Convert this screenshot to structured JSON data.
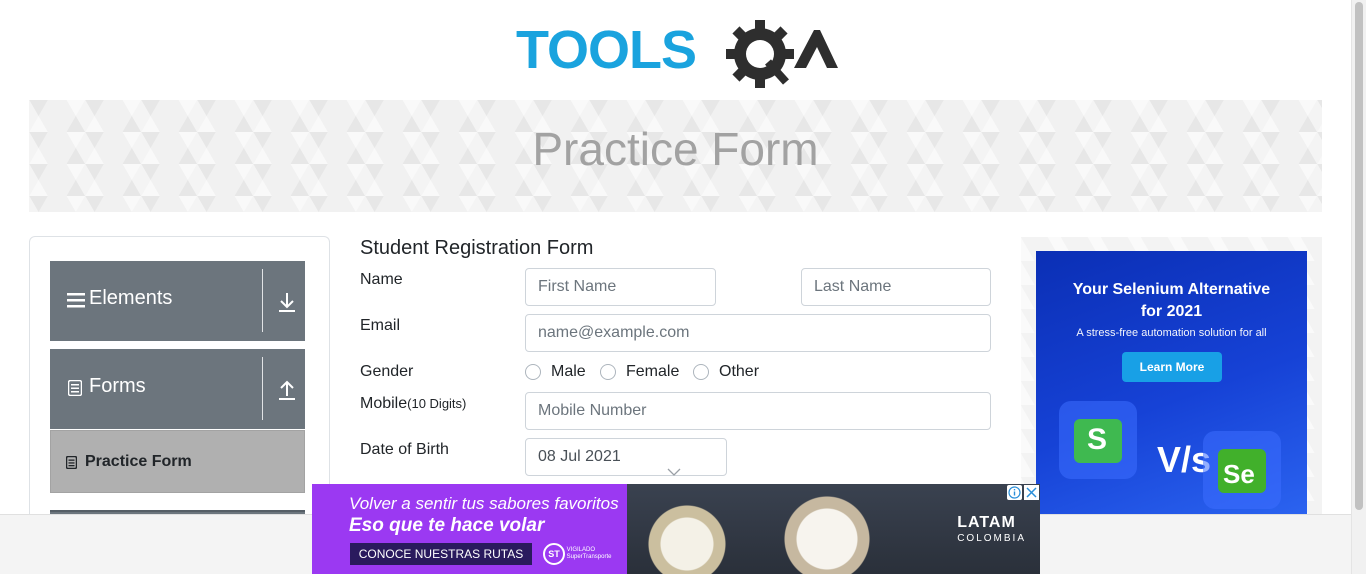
{
  "header": {
    "logo_text": "TOOLSQA",
    "logo_colors": {
      "tools": "#1aa3de",
      "qa": "#2e2e2e"
    }
  },
  "banner": {
    "title": "Practice Form"
  },
  "sidebar": {
    "groups": [
      {
        "label": "Elements",
        "icon": "hamburger-icon",
        "arrow": "download-arrow-icon"
      },
      {
        "label": "Forms",
        "icon": "document-icon",
        "arrow": "upload-arrow-icon"
      }
    ],
    "active_item": {
      "label": "Practice Form",
      "icon": "form-icon"
    }
  },
  "form": {
    "title": "Student Registration Form",
    "name_label": "Name",
    "first_name_placeholder": "First Name",
    "last_name_placeholder": "Last Name",
    "email_label": "Email",
    "email_placeholder": "name@example.com",
    "gender_label": "Gender",
    "gender_options": [
      "Male",
      "Female",
      "Other"
    ],
    "mobile_label": "Mobile",
    "mobile_hint": "(10 Digits)",
    "mobile_placeholder": "Mobile Number",
    "dob_label": "Date of Birth",
    "dob_value": "08 Jul 2021"
  },
  "ad_right": {
    "headline_1": "Your Selenium Alternative",
    "headline_2": "for 2021",
    "subtext": "A stress-free automation solution for all",
    "button": "Learn More",
    "vs_text": "V/s",
    "logo_left": "S",
    "logo_right": "Se",
    "accent": "#18a0e6"
  },
  "ad_bottom": {
    "line1": "Volver a sentir tus sabores favoritos",
    "line2": "Eso que te hace volar",
    "cta": "CONOCE NUESTRAS RUTAS",
    "st_logo": "ST",
    "st_text": "VIGILADO SuperTransporte",
    "brand": "LATAM",
    "brand_sub": "COLOMBIA",
    "accent": "#9b39f2"
  }
}
